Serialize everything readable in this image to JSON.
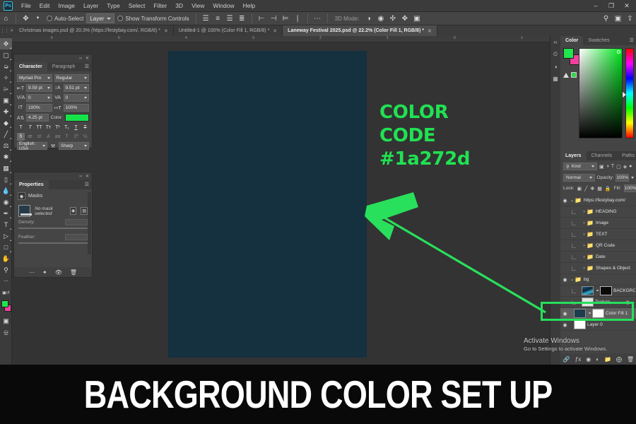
{
  "app": {
    "name": "Adobe Photoshop",
    "logo_text": "Ps"
  },
  "menubar": {
    "items": [
      "File",
      "Edit",
      "Image",
      "Layer",
      "Type",
      "Select",
      "Filter",
      "3D",
      "View",
      "Window",
      "Help"
    ],
    "window_controls": [
      "–",
      "❐",
      "✕"
    ]
  },
  "optionsbar": {
    "home_icon": "home-icon",
    "tool_icon": "move-tool-icon",
    "auto_select_label": "Auto-Select",
    "layer_dropdown_value": "Layer",
    "show_transform_label": "Show Transform Controls",
    "three_d_mode_label": "3D Mode:",
    "align_icons": [
      "align-left",
      "align-center-h",
      "align-right",
      "align-distribute-h"
    ],
    "distribute_icons": [
      "align-top",
      "align-center-v",
      "align-bottom",
      "distribute-v"
    ],
    "more_icon": "ellipsis-icon",
    "mode_3d_icons": [
      "orbit-3d-icon",
      "roll-3d-icon",
      "pan-3d-icon",
      "slide-3d-icon",
      "scale-3d-icon"
    ],
    "right_icons": [
      "search-icon",
      "workspace-icon",
      "share-icon"
    ]
  },
  "tabs": [
    {
      "title": "Christmas images.psd @ 20.3% (https://festybay.com/, RGB/8) *",
      "active": false
    },
    {
      "title": "Untitled-1 @ 100% (Color Fill 1, RGB/8) *",
      "active": false
    },
    {
      "title": "Laneway Festival 2025.psd @ 22.2% (Color Fill 1, RGB/8) *",
      "active": true
    }
  ],
  "toolbar": {
    "tools": [
      "move-tool",
      "marquee-tool",
      "lasso-tool",
      "quick-selection-tool",
      "crop-tool",
      "frame-tool",
      "eyedropper-tool",
      "spot-healing-tool",
      "brush-tool",
      "clone-stamp-tool",
      "history-brush-tool",
      "eraser-tool",
      "gradient-tool",
      "blur-tool",
      "dodge-tool",
      "pen-tool",
      "type-tool",
      "path-selection-tool",
      "rectangle-tool",
      "hand-tool",
      "zoom-tool",
      "edit-toolbar"
    ],
    "foreground_color": "#22e44c",
    "background_color": "#f23fa0",
    "quickmask_icon": "quick-mask-icon",
    "screenmode_icon": "screen-mode-icon"
  },
  "canvas": {
    "document_background_color": "#15303f",
    "workspace_color": "#333333",
    "ruler_ticks": [
      "6",
      "5",
      "4",
      "3",
      "2",
      "1",
      "0",
      "1",
      "2"
    ]
  },
  "character_panel": {
    "tabs": [
      {
        "label": "Character",
        "active": true
      },
      {
        "label": "Paragraph",
        "active": false
      }
    ],
    "font_family": "Myriad Pro",
    "font_style": "Regular",
    "font_size": "9.59 pt",
    "leading": "9.51 pt",
    "tracking": "0",
    "kerning": "0",
    "vertical_scale": "100%",
    "horizontal_scale": "100%",
    "baseline_shift": "4.25 pt",
    "color_label": "Color:",
    "color_value": "#16e24a",
    "language": "English: USA",
    "anti_alias": "Sharp",
    "style_glyphs": [
      "T",
      "T",
      "TT",
      "Tt",
      "T¹",
      "T₁",
      "T",
      "T̶"
    ],
    "feature_glyphs": [
      "fi",
      "œ",
      "st",
      "A",
      "aa",
      "T",
      "1st",
      "½"
    ]
  },
  "properties_panel": {
    "tabs": [
      {
        "label": "Properties",
        "active": true
      }
    ],
    "section_title": "Masks",
    "mask_status": "No mask selected",
    "density_label": "Density:",
    "feather_label": "Feather:",
    "footer_icons": [
      "select-subject-icon",
      "mask-edge-icon",
      "visibility-icon",
      "delete-icon"
    ]
  },
  "color_panel": {
    "tabs": [
      {
        "label": "Color",
        "active": true
      },
      {
        "label": "Swatches",
        "active": false
      }
    ],
    "foreground_color": "#22e44c",
    "background_color": "#f23fa0",
    "menu_icon": "panel-menu-icon",
    "warning_icon": "out-of-gamut-icon"
  },
  "layers_panel": {
    "tabs": [
      {
        "label": "Layers",
        "active": true
      },
      {
        "label": "Channels",
        "active": false
      },
      {
        "label": "Paths",
        "active": false
      }
    ],
    "filter_label": "Kind",
    "filter_icons": [
      "pixel-filter-icon",
      "adjustment-filter-icon",
      "type-filter-icon",
      "shape-filter-icon",
      "smartobject-filter-icon"
    ],
    "blend_mode": "Normal",
    "opacity_label": "Opacity:",
    "opacity_value": "100%",
    "lock_label": "Lock:",
    "lock_icons": [
      "lock-transparent-icon",
      "lock-image-icon",
      "lock-position-icon",
      "lock-artboard-icon",
      "lock-all-icon"
    ],
    "fill_label": "Fill:",
    "fill_value": "100%",
    "layers": [
      {
        "name": "https://festybay.com/",
        "type": "group",
        "visible": true,
        "expanded": true,
        "indent": 0,
        "selected": false
      },
      {
        "name": "HEADING",
        "type": "group",
        "visible": false,
        "expanded": false,
        "indent": 1,
        "selected": false
      },
      {
        "name": "Image",
        "type": "group",
        "visible": false,
        "expanded": false,
        "indent": 1,
        "selected": false
      },
      {
        "name": "TEXT",
        "type": "group",
        "visible": false,
        "expanded": false,
        "indent": 1,
        "selected": false
      },
      {
        "name": "QR Code",
        "type": "group",
        "visible": false,
        "expanded": false,
        "indent": 1,
        "selected": false
      },
      {
        "name": "Date",
        "type": "group",
        "visible": false,
        "expanded": false,
        "indent": 1,
        "selected": false
      },
      {
        "name": "Shapes & Object",
        "type": "group",
        "visible": false,
        "expanded": false,
        "indent": 1,
        "selected": false
      },
      {
        "name": "bg",
        "type": "group",
        "visible": true,
        "expanded": true,
        "indent": 0,
        "selected": false
      },
      {
        "name": "BACKGROUND",
        "type": "layer-masked",
        "visible": false,
        "indent": 1,
        "selected": false
      },
      {
        "name": "Texture",
        "type": "layer-dots",
        "visible": false,
        "indent": 1,
        "selected": false
      },
      {
        "name": "Color Fill 1",
        "type": "layer-fill",
        "visible": true,
        "indent": 1,
        "selected": true
      },
      {
        "name": "Layer 0",
        "type": "layer-plain",
        "visible": true,
        "indent": 1,
        "selected": false
      }
    ],
    "footer_icons": [
      "link-layers-icon",
      "layer-style-icon",
      "layer-mask-icon",
      "adjustment-layer-icon",
      "new-group-icon",
      "new-layer-icon",
      "delete-layer-icon"
    ]
  },
  "annotation": {
    "line1": "COLOR",
    "line2": "CODE",
    "line3": "#1a272d",
    "color": "#20e252",
    "arrow_icon": "green-arrow-pointing-to-canvas",
    "highlight_box_icon": "green-highlight-box-on-color-fill-layer"
  },
  "watermark": {
    "title": "Activate Windows",
    "subtitle": "Go to Settings to activate Windows."
  },
  "banner": {
    "text": "BACKGROUND  COLOR SET UP",
    "background_color": "#090909",
    "text_color": "#ffffff"
  }
}
